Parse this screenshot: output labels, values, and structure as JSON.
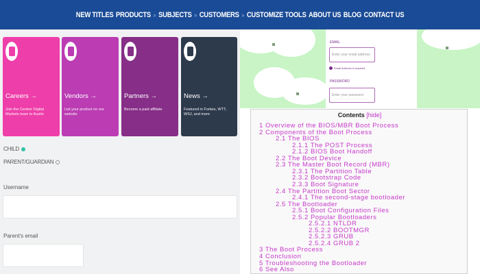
{
  "nav": {
    "links": [
      "NEW TITLES",
      "PRODUCTS",
      "SUBJECTS",
      "CUSTOMERS",
      "CUSTOMIZE TOOLS",
      "ABOUT US",
      "BLOG",
      "CONTACT US"
    ],
    "background": "#1a4b96"
  },
  "cards": [
    {
      "title": "Careers →",
      "desc": "Join the Centrer Digital Markets team to Austin",
      "color": "#ee3ea9",
      "icon": "people-icon"
    },
    {
      "title": "Vendors →",
      "desc": "List your product on our website",
      "color": "#bb3cb3",
      "icon": "store-icon"
    },
    {
      "title": "Partners →",
      "desc": "Become a paid affiliate",
      "color": "#862e88",
      "icon": "handshake-icon"
    },
    {
      "title": "News →",
      "desc": "Featured in Forbes, WTT, WSJ, and more",
      "color": "#2d3a4c",
      "icon": "document-icon"
    }
  ],
  "form": {
    "child_label": "CHILD",
    "parent_label": "PARENT/GUARDIAN",
    "username_label": "Username",
    "parent_email_label": "Parent's email"
  },
  "login": {
    "email_label": "EMAIL",
    "email_placeholder": "Enter your email address",
    "email_check": "Email Address is required",
    "password_label": "PASSWORD",
    "password_placeholder": "Enter your password"
  },
  "toc": {
    "heading": "Contents",
    "hide_label": "[hide]",
    "items": [
      {
        "text": "1 Overview of the BIOS/MBR Boot Process",
        "level": 0
      },
      {
        "text": "2 Components of the Boot Process",
        "level": 0
      },
      {
        "text": "2.1 The BIOS",
        "level": 1
      },
      {
        "text": "2.1.1 The POST Process",
        "level": 2
      },
      {
        "text": "2.1.2 BIOS Boot Handoff",
        "level": 2
      },
      {
        "text": "2.2 The Boot Device",
        "level": 1
      },
      {
        "text": "2.3 The Master Boot Record (MBR)",
        "level": 1
      },
      {
        "text": "2.3.1 The Partition Table",
        "level": 2
      },
      {
        "text": "2.3.2 Bootstrap Code",
        "level": 2
      },
      {
        "text": "2.3.3 Boot Signature",
        "level": 2
      },
      {
        "text": "2.4 The Partition Boot Sector",
        "level": 1
      },
      {
        "text": "2.4.1 The second-stage bootloader",
        "level": 2
      },
      {
        "text": "2.5 The Bootloader",
        "level": 1
      },
      {
        "text": "2.5.1 Boot Configuration Files",
        "level": 2
      },
      {
        "text": "2.5.2 Popular Bootloaders",
        "level": 2
      },
      {
        "text": "2.5.2.1 NTLDR",
        "level": 3
      },
      {
        "text": "2.5.2.2 BOOTMGR",
        "level": 3
      },
      {
        "text": "2.5.2.3 GRUB",
        "level": 3
      },
      {
        "text": "2.5.2.4 GRUB 2",
        "level": 3
      },
      {
        "text": "3 The Boot Process",
        "level": 0
      },
      {
        "text": "4 Conclusion",
        "level": 0
      },
      {
        "text": "5 Troubleshooting the Bootloader",
        "level": 0
      },
      {
        "text": "6 See Also",
        "level": 0
      }
    ],
    "link_color": "#c538c9"
  }
}
